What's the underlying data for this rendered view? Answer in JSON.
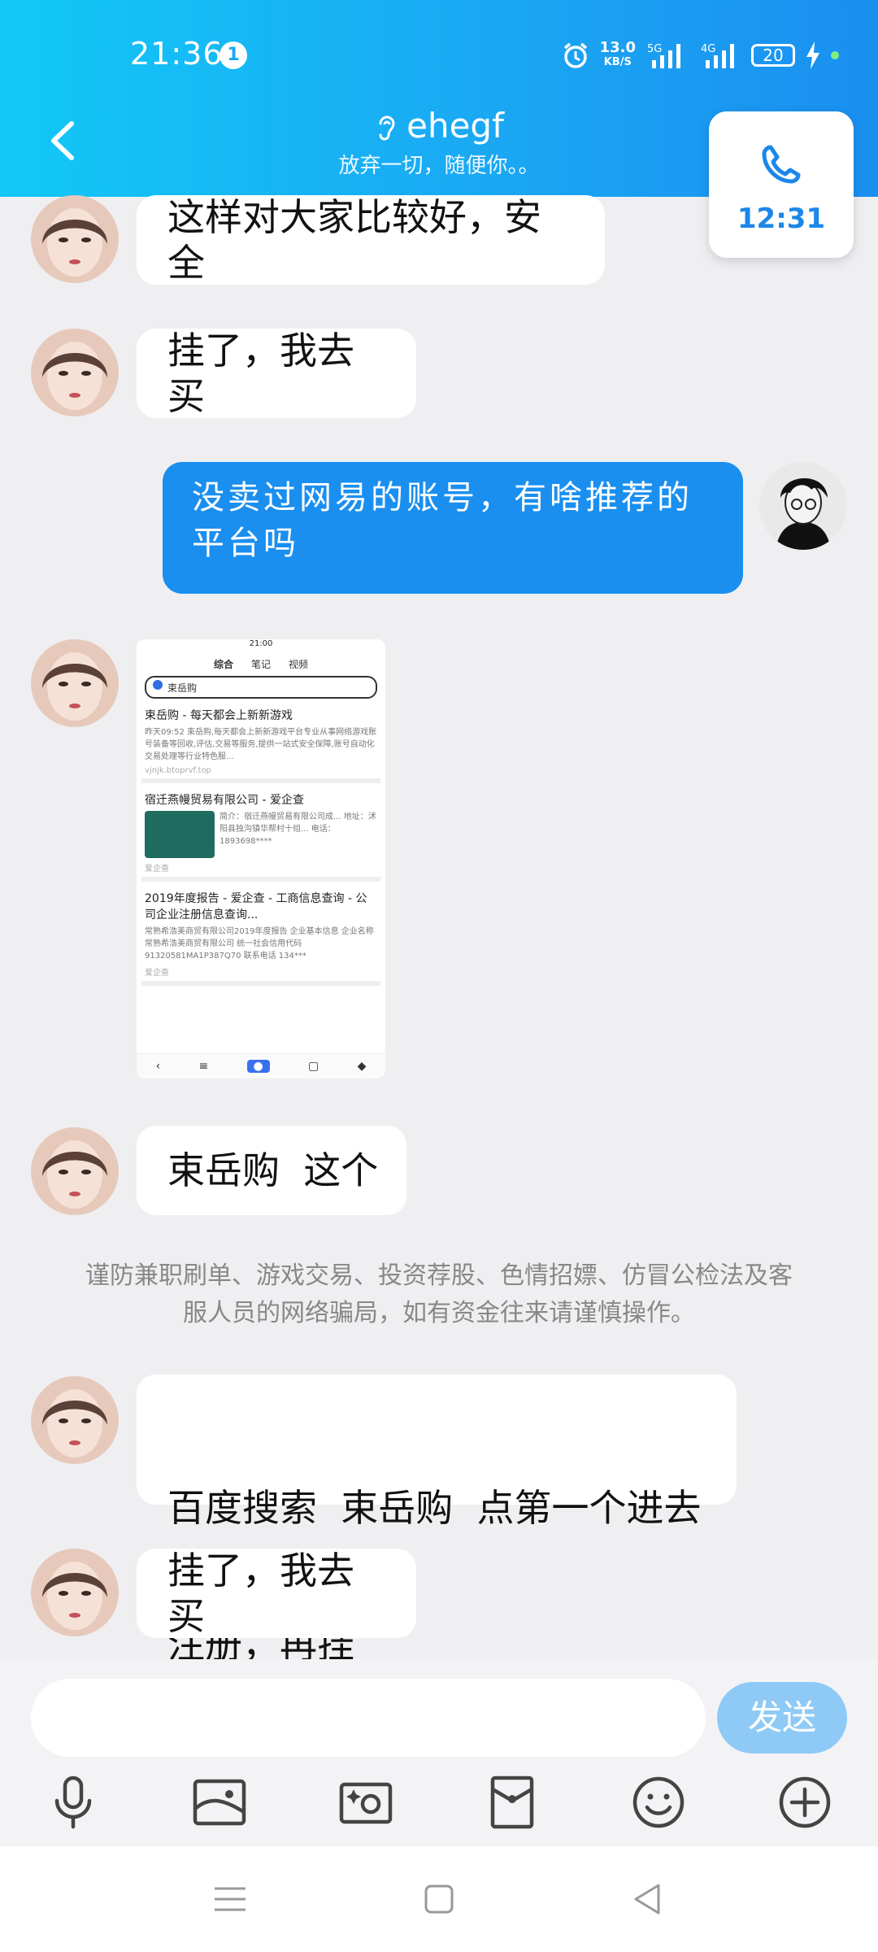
{
  "status": {
    "time": "21:36",
    "notif_count": "1",
    "speed_value": "13.0",
    "speed_unit": "KB/S",
    "net1": "5G",
    "net2": "4G",
    "battery": "20"
  },
  "header": {
    "title": "ehegf",
    "subtitle": "放弃一切，随便你。。",
    "back_icon": "chevron-left-icon",
    "ear_icon": "ear-icon"
  },
  "call": {
    "duration": "12:31",
    "icon": "phone-icon"
  },
  "messages": [
    {
      "side": "in",
      "text": "这样对大家比较好，安全"
    },
    {
      "side": "in",
      "text": "挂了，我去买"
    },
    {
      "side": "out",
      "line1": "没卖过网易的账号，有啥推荐的",
      "line2": "平台吗"
    },
    {
      "side": "in",
      "type": "image"
    },
    {
      "side": "in",
      "text": "束岳购  这个"
    },
    {
      "side": "in",
      "line1": "百度搜索  束岳购  点第一个进去",
      "line2": "注册，再挂"
    },
    {
      "side": "in",
      "text": "挂了，我去买"
    }
  ],
  "warning": {
    "line1": "谨防兼职刷单、游戏交易、投资荐股、色情招嫖、仿冒公检法及客",
    "line2": "服人员的网络骗局，如有资金往来请谨慎操作。"
  },
  "screenshot": {
    "time": "21:00",
    "tabs": [
      "综合",
      "笔记",
      "视频"
    ],
    "query": "束岳购",
    "results": [
      {
        "title": "束岳购 - 每天都会上新新游戏",
        "desc": "昨天09:52 束岳购,每天都会上新新游戏平台专业从事网络游戏账号装备等回收,评估,交易等服务,提供一站式安全保障,账号自动化交易处理等行业特色服...",
        "foot": "vjnjk.btoprvf.top"
      },
      {
        "title": "宿迁燕幔贸易有限公司 - 爱企查",
        "desc": "简介：宿迁燕幔贸易有限公司成... 地址：沭阳县独沟镇华帮村十组... 电话：1893698****",
        "foot": "爱企查"
      },
      {
        "title": "2019年度报告 - 爱企查 - 工商信息查询 - 公司企业注册信息查询...",
        "desc": "常熟希浩美商贸有限公司2019年度报告 企业基本信息 企业名称 常熟希浩美商贸有限公司 统一社会信用代码 91320581MA1P387Q70 联系电话 134***",
        "foot": "爱企查"
      }
    ]
  },
  "composer": {
    "send_label": "发送",
    "tools": [
      "microphone-icon",
      "image-icon",
      "camera-icon",
      "red-packet-icon",
      "emoji-icon",
      "plus-icon"
    ]
  },
  "navbar": {
    "icons": [
      "menu-icon",
      "home-icon",
      "back-icon"
    ]
  }
}
